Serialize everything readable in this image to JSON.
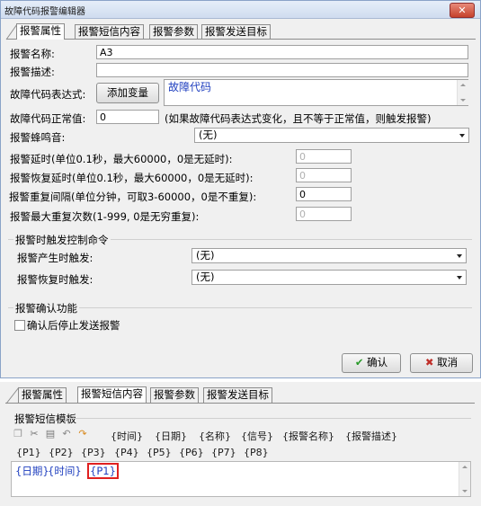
{
  "window": {
    "title": "故障代码报警编辑器",
    "close": "✕"
  },
  "tabs": [
    "报警属性",
    "报警短信内容",
    "报警参数",
    "报警发送目标"
  ],
  "form": {
    "name_label": "报警名称:",
    "name_value": "A3",
    "desc_label": "报警描述:",
    "desc_value": "",
    "expr_label": "故障代码表达式:",
    "add_var": "添加变量",
    "expr_value": "故障代码",
    "normal_label": "故障代码正常值:",
    "normal_value": "0",
    "normal_hint": "(如果故障代码表达式变化，且不等于正常值，则触发报警)",
    "buzzer_label": "报警蜂鸣音:",
    "buzzer_value": "(无)",
    "delay_label": "报警延时(单位0.1秒，最大60000，0是无延时):",
    "delay_value": "0",
    "recover_label": "报警恢复延时(单位0.1秒，最大60000，0是无延时):",
    "recover_value": "0",
    "repeat_label": "报警重复间隔(单位分钟，可取3-60000，0是不重复):",
    "repeat_value": "0",
    "maxrep_label": "报警最大重复次数(1-999, 0是无穷重复):",
    "maxrep_value": "0"
  },
  "trigger": {
    "group_title": "报警时触发控制命令",
    "on_label": "报警产生时触发:",
    "on_value": "(无)",
    "off_label": "报警恢复时触发:",
    "off_value": "(无)"
  },
  "confirm": {
    "group_title": "报警确认功能",
    "checkbox_label": "确认后停止发送报警"
  },
  "buttons": {
    "ok": "确认",
    "cancel": "取消"
  },
  "sms": {
    "tabs": [
      "报警属性",
      "报警短信内容",
      "报警参数",
      "报警发送目标"
    ],
    "group_title": "报警短信模板",
    "tokens_row1": [
      "{时间}",
      "{日期}",
      "{名称}",
      "{信号}",
      "{报警名称}",
      "{报警描述}"
    ],
    "tokens_row2": [
      "{P1}",
      "{P2}",
      "{P3}",
      "{P4}",
      "{P5}",
      "{P6}",
      "{P7}",
      "{P8}"
    ],
    "content": [
      "{日期}",
      "{时间}",
      "{P1}"
    ]
  },
  "colors": {
    "accent_blue": "#1f3fbf",
    "highlight_red": "#e02020",
    "check_green": "#2a9a2a",
    "cancel_red": "#c0302a"
  }
}
